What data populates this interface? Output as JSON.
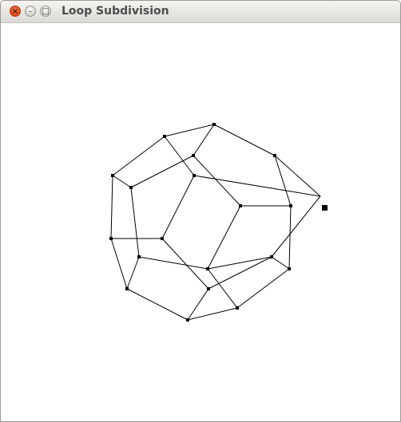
{
  "window": {
    "title": "Loop Subdivision",
    "close_glyph": "×",
    "minimize_glyph": "–",
    "maximize_glyph": "□",
    "icons": [
      "close-icon",
      "minimize-icon",
      "maximize-icon"
    ]
  },
  "colors": {
    "titlebar": "#dcdad5",
    "title_text": "#4d4d4b",
    "close_button": "#dd4814",
    "mesh_stroke": "#000000",
    "vertex_fill": "#000000",
    "canvas_background": "#ffffff"
  }
}
